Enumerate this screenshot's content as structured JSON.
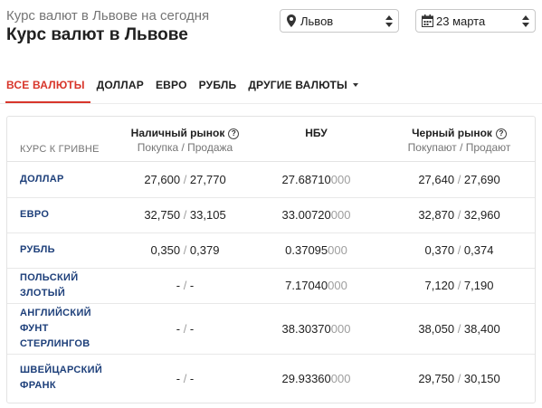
{
  "header": {
    "subtitle": "Курс валют в Львове на сегодня",
    "title": "Курс валют в Львове"
  },
  "filters": {
    "city": "Львов",
    "date": "23 марта"
  },
  "tabs": [
    {
      "label": "ВСЕ ВАЛЮТЫ",
      "active": true
    },
    {
      "label": "ДОЛЛАР",
      "active": false
    },
    {
      "label": "ЕВРО",
      "active": false
    },
    {
      "label": "РУБЛЬ",
      "active": false
    },
    {
      "label": "ДРУГИЕ ВАЛЮТЫ",
      "active": false,
      "dropdown": true
    }
  ],
  "table": {
    "header": {
      "label": "КУРС К ГРИВНЕ",
      "cash_title": "Наличный рынок",
      "cash_sub": "Покупка / Продажа",
      "nbu_title": "НБУ",
      "black_title": "Черный рынок",
      "black_sub": "Покупают / Продают"
    },
    "rows": [
      {
        "name": "ДОЛЛАР",
        "cash_buy": "27,600",
        "cash_sell": "27,770",
        "nbu_main": "27.68710",
        "nbu_tail": "000",
        "black_buy": "27,640",
        "black_sell": "27,690"
      },
      {
        "name": "ЕВРО",
        "cash_buy": "32,750",
        "cash_sell": "33,105",
        "nbu_main": "33.00720",
        "nbu_tail": "000",
        "black_buy": "32,870",
        "black_sell": "32,960"
      },
      {
        "name": "РУБЛЬ",
        "cash_buy": "0,350",
        "cash_sell": "0,379",
        "nbu_main": "0.37095",
        "nbu_tail": "000",
        "black_buy": "0,370",
        "black_sell": "0,374"
      },
      {
        "name": "ПОЛЬСКИЙ ЗЛОТЫЙ",
        "cash_buy": "-",
        "cash_sell": "-",
        "nbu_main": "7.17040",
        "nbu_tail": "000",
        "black_buy": "7,120",
        "black_sell": "7,190"
      },
      {
        "name": "АНГЛИЙСКИЙ ФУНТ СТЕРЛИНГОВ",
        "cash_buy": "-",
        "cash_sell": "-",
        "nbu_main": "38.30370",
        "nbu_tail": "000",
        "black_buy": "38,050",
        "black_sell": "38,400"
      },
      {
        "name": "ШВЕЙЦАРСКИЙ ФРАНК",
        "cash_buy": "-",
        "cash_sell": "-",
        "nbu_main": "29.93360",
        "nbu_tail": "000",
        "black_buy": "29,750",
        "black_sell": "30,150"
      }
    ]
  },
  "colors": {
    "accent": "#d8362b",
    "link": "#1d3f7a"
  },
  "icons": {
    "city": "map-pin-icon",
    "date": "calendar-icon",
    "help": "help-circle-icon"
  }
}
